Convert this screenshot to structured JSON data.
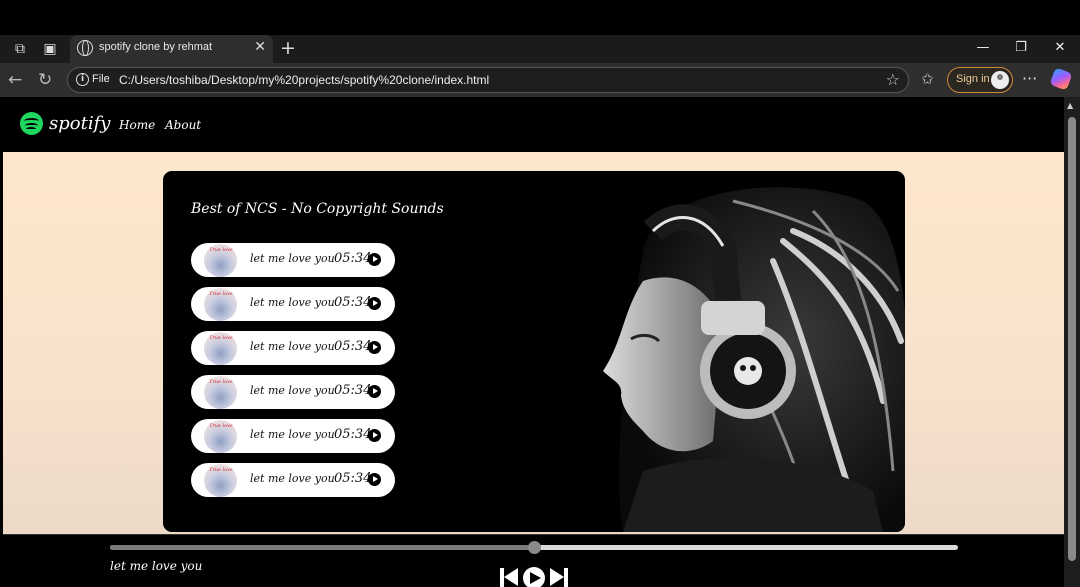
{
  "browser": {
    "tab_title": "spotify clone by rehmat",
    "address_label": "File",
    "url": "C:/Users/toshiba/Desktop/my%20projects/spotify%20clone/index.html",
    "signin_label": "Sign in",
    "icons": [
      "workspaces-icon",
      "tab-actions-icon",
      "globe-icon",
      "close-tab-icon",
      "new-tab-icon",
      "minimize-icon",
      "restore-icon",
      "close-window-icon",
      "back-icon",
      "refresh-icon",
      "info-icon",
      "favorite-star-icon",
      "favorites-icon",
      "profile-avatar-icon",
      "more-menu-icon",
      "copilot-icon"
    ]
  },
  "nav": {
    "brand": "spotify",
    "links": [
      "Home",
      "About"
    ],
    "brand_color": "#1ed760"
  },
  "playlist": {
    "title": "Best of NCS - No Copyright Sounds",
    "songs": [
      {
        "name": "let me love you",
        "duration": "05:34"
      },
      {
        "name": "let me love you",
        "duration": "05:34"
      },
      {
        "name": "let me love you",
        "duration": "05:34"
      },
      {
        "name": "let me love you",
        "duration": "05:34"
      },
      {
        "name": "let me love you",
        "duration": "05:34"
      },
      {
        "name": "let me love you",
        "duration": "05:34"
      }
    ],
    "thumb_caption": "True love"
  },
  "player": {
    "now_playing": "let me love you",
    "progress_fraction": 0.5
  }
}
